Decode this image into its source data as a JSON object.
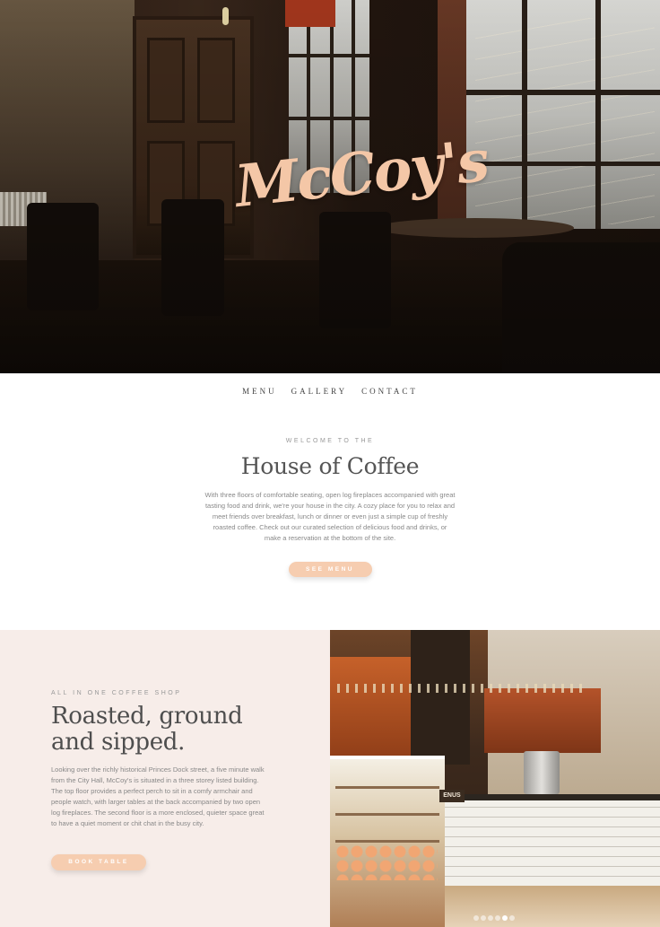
{
  "hero": {
    "logo_text": "McCoy's"
  },
  "nav": {
    "items": [
      "MENU",
      "GALLERY",
      "CONTACT"
    ]
  },
  "intro": {
    "eyebrow": "WELCOME TO THE",
    "title": "House of Coffee",
    "body": "With three floors of comfortable seating, open log fireplaces accompanied with great tasting food and drink, we're your house in the city. A cozy place for you to relax and meet friends over breakfast, lunch or dinner or even just a simple cup of freshly roasted coffee. Check out our curated selection of delicious food and drinks, or make a reservation at the bottom of the site.",
    "button_label": "SEE MENU"
  },
  "feature": {
    "eyebrow": "ALL IN ONE COFFEE SHOP",
    "title_line1": "Roasted, ground",
    "title_line2": "and sipped.",
    "body": "Looking over the richly historical Princes Dock street, a five minute walk from the City Hall, McCoy's is situated in a three storey listed building. The top floor provides a perfect perch to sit in a comfy armchair and people watch, with larger tables at the back accompanied by two open log fireplaces. The second floor is a more enclosed, quieter space great to have a quiet moment or chit chat in the busy city.",
    "button_label": "BOOK TABLE"
  },
  "photo": {
    "sign_text": "ENUS",
    "slide_count": 6,
    "active_slide": 5
  },
  "colors": {
    "accent": "#f6cdb0",
    "logo": "#f4c7a7",
    "feature_bg": "#f7ede9"
  }
}
